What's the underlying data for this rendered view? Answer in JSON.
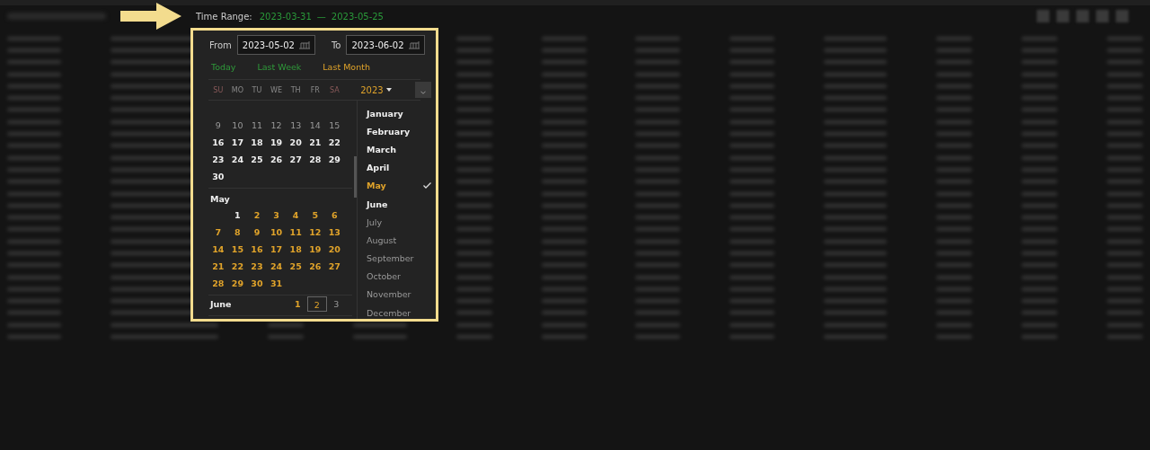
{
  "time_range": {
    "label": "Time Range:",
    "start": "2023-03-31",
    "separator": "—",
    "end": "2023-05-25"
  },
  "picker": {
    "from": {
      "label": "From",
      "value": "2023-05-02"
    },
    "to": {
      "label": "To",
      "value": "2023-06-02"
    },
    "quick_ranges": [
      {
        "label": "Today",
        "selected": false
      },
      {
        "label": "Last Week",
        "selected": false
      },
      {
        "label": "Last Month",
        "selected": true
      }
    ],
    "weekdays": [
      {
        "label": "SU",
        "weekend": true
      },
      {
        "label": "MO",
        "weekend": false
      },
      {
        "label": "TU",
        "weekend": false
      },
      {
        "label": "WE",
        "weekend": false
      },
      {
        "label": "TH",
        "weekend": false
      },
      {
        "label": "FR",
        "weekend": false
      },
      {
        "label": "SA",
        "weekend": true
      }
    ],
    "year": "2023",
    "months": [
      {
        "weeks": [
          [
            {
              "kind": "day",
              "day": "9",
              "faded": true,
              "in_range": false,
              "selected": false
            },
            {
              "kind": "day",
              "day": "10",
              "faded": true,
              "in_range": false,
              "selected": false
            },
            {
              "kind": "day",
              "day": "11",
              "faded": true,
              "in_range": false,
              "selected": false
            },
            {
              "kind": "day",
              "day": "12",
              "faded": true,
              "in_range": false,
              "selected": false
            },
            {
              "kind": "day",
              "day": "13",
              "faded": true,
              "in_range": false,
              "selected": false
            },
            {
              "kind": "day",
              "day": "14",
              "faded": true,
              "in_range": false,
              "selected": false
            },
            {
              "kind": "day",
              "day": "15",
              "faded": true,
              "in_range": false,
              "selected": false
            }
          ],
          [
            {
              "kind": "day",
              "day": "16",
              "faded": false,
              "in_range": false,
              "selected": false
            },
            {
              "kind": "day",
              "day": "17",
              "faded": false,
              "in_range": false,
              "selected": false
            },
            {
              "kind": "day",
              "day": "18",
              "faded": false,
              "in_range": false,
              "selected": false
            },
            {
              "kind": "day",
              "day": "19",
              "faded": false,
              "in_range": false,
              "selected": false
            },
            {
              "kind": "day",
              "day": "20",
              "faded": false,
              "in_range": false,
              "selected": false
            },
            {
              "kind": "day",
              "day": "21",
              "faded": false,
              "in_range": false,
              "selected": false
            },
            {
              "kind": "day",
              "day": "22",
              "faded": false,
              "in_range": false,
              "selected": false
            }
          ],
          [
            {
              "kind": "day",
              "day": "23",
              "faded": false,
              "in_range": false,
              "selected": false
            },
            {
              "kind": "day",
              "day": "24",
              "faded": false,
              "in_range": false,
              "selected": false
            },
            {
              "kind": "day",
              "day": "25",
              "faded": false,
              "in_range": false,
              "selected": false
            },
            {
              "kind": "day",
              "day": "26",
              "faded": false,
              "in_range": false,
              "selected": false
            },
            {
              "kind": "day",
              "day": "27",
              "faded": false,
              "in_range": false,
              "selected": false
            },
            {
              "kind": "day",
              "day": "28",
              "faded": false,
              "in_range": false,
              "selected": false
            },
            {
              "kind": "day",
              "day": "29",
              "faded": false,
              "in_range": false,
              "selected": false
            }
          ],
          [
            {
              "kind": "day",
              "day": "30",
              "faded": false,
              "in_range": false,
              "selected": false
            },
            {
              "kind": "blank"
            },
            {
              "kind": "blank"
            },
            {
              "kind": "blank"
            },
            {
              "kind": "blank"
            },
            {
              "kind": "blank"
            },
            {
              "kind": "blank"
            }
          ]
        ]
      },
      {
        "name": "May",
        "weeks": [
          [
            {
              "kind": "blank"
            },
            {
              "kind": "day",
              "day": "1",
              "faded": false,
              "in_range": false,
              "selected": false
            },
            {
              "kind": "day",
              "day": "2",
              "faded": false,
              "in_range": true,
              "selected": false
            },
            {
              "kind": "day",
              "day": "3",
              "faded": false,
              "in_range": true,
              "selected": false
            },
            {
              "kind": "day",
              "day": "4",
              "faded": false,
              "in_range": true,
              "selected": false
            },
            {
              "kind": "day",
              "day": "5",
              "faded": false,
              "in_range": true,
              "selected": false
            },
            {
              "kind": "day",
              "day": "6",
              "faded": false,
              "in_range": true,
              "selected": false
            }
          ],
          [
            {
              "kind": "day",
              "day": "7",
              "faded": false,
              "in_range": true,
              "selected": false
            },
            {
              "kind": "day",
              "day": "8",
              "faded": false,
              "in_range": true,
              "selected": false
            },
            {
              "kind": "day",
              "day": "9",
              "faded": false,
              "in_range": true,
              "selected": false
            },
            {
              "kind": "day",
              "day": "10",
              "faded": false,
              "in_range": true,
              "selected": false
            },
            {
              "kind": "day",
              "day": "11",
              "faded": false,
              "in_range": true,
              "selected": false
            },
            {
              "kind": "day",
              "day": "12",
              "faded": false,
              "in_range": true,
              "selected": false
            },
            {
              "kind": "day",
              "day": "13",
              "faded": false,
              "in_range": true,
              "selected": false
            }
          ],
          [
            {
              "kind": "day",
              "day": "14",
              "faded": false,
              "in_range": true,
              "selected": false
            },
            {
              "kind": "day",
              "day": "15",
              "faded": false,
              "in_range": true,
              "selected": false
            },
            {
              "kind": "day",
              "day": "16",
              "faded": false,
              "in_range": true,
              "selected": false
            },
            {
              "kind": "day",
              "day": "17",
              "faded": false,
              "in_range": true,
              "selected": false
            },
            {
              "kind": "day",
              "day": "18",
              "faded": false,
              "in_range": true,
              "selected": false
            },
            {
              "kind": "day",
              "day": "19",
              "faded": false,
              "in_range": true,
              "selected": false
            },
            {
              "kind": "day",
              "day": "20",
              "faded": false,
              "in_range": true,
              "selected": false
            }
          ],
          [
            {
              "kind": "day",
              "day": "21",
              "faded": false,
              "in_range": true,
              "selected": false
            },
            {
              "kind": "day",
              "day": "22",
              "faded": false,
              "in_range": true,
              "selected": false
            },
            {
              "kind": "day",
              "day": "23",
              "faded": false,
              "in_range": true,
              "selected": false
            },
            {
              "kind": "day",
              "day": "24",
              "faded": false,
              "in_range": true,
              "selected": false
            },
            {
              "kind": "day",
              "day": "25",
              "faded": false,
              "in_range": true,
              "selected": false
            },
            {
              "kind": "day",
              "day": "26",
              "faded": false,
              "in_range": true,
              "selected": false
            },
            {
              "kind": "day",
              "day": "27",
              "faded": false,
              "in_range": true,
              "selected": false
            }
          ],
          [
            {
              "kind": "day",
              "day": "28",
              "faded": false,
              "in_range": true,
              "selected": false
            },
            {
              "kind": "day",
              "day": "29",
              "faded": false,
              "in_range": true,
              "selected": false
            },
            {
              "kind": "day",
              "day": "30",
              "faded": false,
              "in_range": true,
              "selected": false
            },
            {
              "kind": "day",
              "day": "31",
              "faded": false,
              "in_range": true,
              "selected": false
            },
            {
              "kind": "blank"
            },
            {
              "kind": "blank"
            },
            {
              "kind": "blank"
            }
          ]
        ]
      },
      {
        "name": "June",
        "weeks": [
          [
            {
              "kind": "blank"
            },
            {
              "kind": "blank"
            },
            {
              "kind": "blank"
            },
            {
              "kind": "blank"
            },
            {
              "kind": "day",
              "day": "1",
              "faded": false,
              "in_range": true,
              "selected": false
            },
            {
              "kind": "day",
              "day": "2",
              "faded": false,
              "in_range": true,
              "selected": true
            },
            {
              "kind": "day",
              "day": "3",
              "faded": true,
              "in_range": false,
              "selected": false
            }
          ]
        ]
      }
    ],
    "month_list": [
      {
        "label": "January",
        "selected": false,
        "dim": false
      },
      {
        "label": "February",
        "selected": false,
        "dim": false
      },
      {
        "label": "March",
        "selected": false,
        "dim": false
      },
      {
        "label": "April",
        "selected": false,
        "dim": false
      },
      {
        "label": "May",
        "selected": true,
        "dim": false
      },
      {
        "label": "June",
        "selected": false,
        "dim": false
      },
      {
        "label": "July",
        "selected": false,
        "dim": true
      },
      {
        "label": "August",
        "selected": false,
        "dim": true
      },
      {
        "label": "September",
        "selected": false,
        "dim": true
      },
      {
        "label": "October",
        "selected": false,
        "dim": true
      },
      {
        "label": "November",
        "selected": false,
        "dim": true
      },
      {
        "label": "December",
        "selected": false,
        "dim": true
      }
    ]
  }
}
